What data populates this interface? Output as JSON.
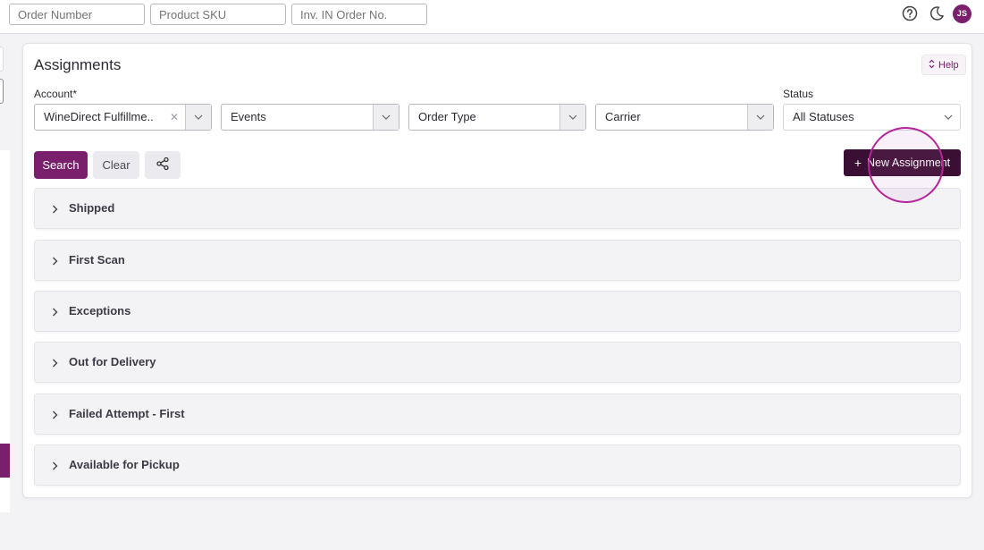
{
  "topbar": {
    "search_fields": [
      {
        "placeholder": "Order Number"
      },
      {
        "placeholder": "Product SKU"
      },
      {
        "placeholder": "Inv. IN Order No."
      }
    ],
    "user_initials": "JS"
  },
  "page": {
    "title": "Assignments",
    "help_label": "Help"
  },
  "filters": {
    "account_label": "Account*",
    "account_value": "WineDirect Fulfillme...",
    "events_value": "Events",
    "order_type_value": "Order Type",
    "carrier_value": "Carrier",
    "status_label": "Status",
    "status_value": "All Statuses"
  },
  "actions": {
    "search_label": "Search",
    "clear_label": "Clear",
    "new_assignment_label": "New Assignment"
  },
  "sections": [
    {
      "label": "Shipped"
    },
    {
      "label": "First Scan"
    },
    {
      "label": "Exceptions"
    },
    {
      "label": "Out for Delivery"
    },
    {
      "label": "Failed Attempt - First"
    },
    {
      "label": "Available for Pickup"
    }
  ],
  "colors": {
    "brand": "#7a1f6c",
    "dark_brand": "#3b0f33",
    "highlight": "#b5259a"
  }
}
